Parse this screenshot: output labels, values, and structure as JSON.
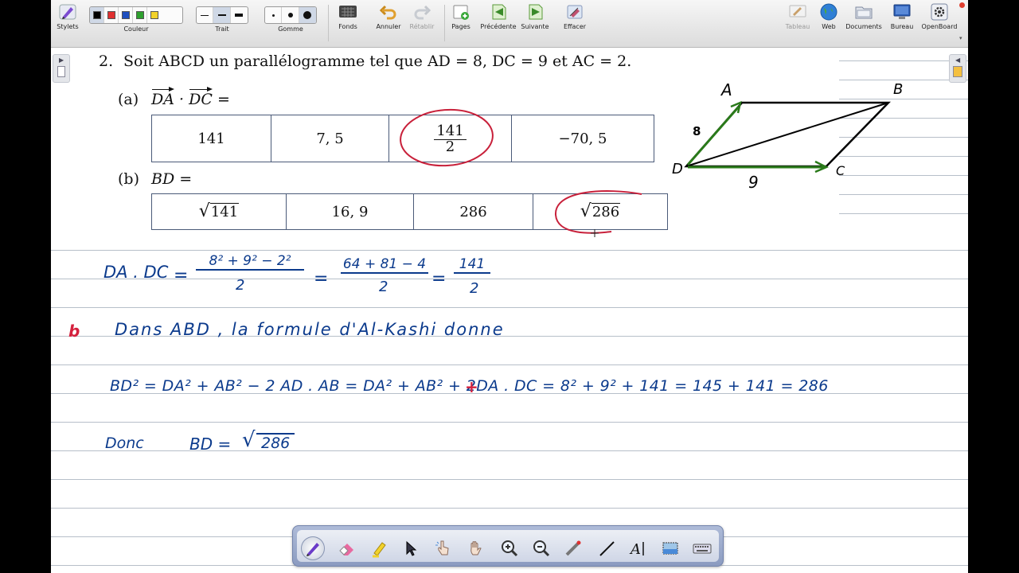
{
  "toolbar": {
    "stylets": "Stylets",
    "couleur": "Couleur",
    "trait": "Trait",
    "gomme": "Gomme",
    "fonds": "Fonds",
    "annuler": "Annuler",
    "retablir": "Rétablir",
    "pages": "Pages",
    "precedente": "Précédente",
    "suivante": "Suivante",
    "effacer": "Effacer",
    "tableau": "Tableau",
    "web": "Web",
    "documents": "Documents",
    "bureau": "Bureau",
    "openboard": "OpenBoard",
    "colors": [
      "#000000",
      "#e03030",
      "#1f4fbf",
      "#2ea02e",
      "#f2d22a"
    ]
  },
  "problem": {
    "number": "2.",
    "statement": "Soit ABCD un parallélogramme tel que AD = 8, DC = 9 et AC = 2.",
    "a_label": "(a)",
    "a_vec1": "DA",
    "a_dot": "·",
    "a_vec2": "DC",
    "a_eq": "=",
    "a_answers": [
      "141",
      "7, 5",
      "141",
      "2",
      "−70, 5"
    ],
    "b_label": "(b)",
    "b_expr": "BD =",
    "b_answers": [
      "141",
      "16, 9",
      "286",
      "286"
    ]
  },
  "figure": {
    "labels": [
      "A",
      "B",
      "D",
      "C",
      "8",
      "9"
    ]
  },
  "handwriting": {
    "line1_left": "DA . DC",
    "line1_eq": "=",
    "line1_frac1_num": "8² + 9² − 2²",
    "line1_frac1_den": "2",
    "line1_frac2_num": "64 + 81 − 4",
    "line1_frac2_den": "2",
    "line1_frac3_num": "141",
    "line1_frac3_den": "2",
    "b_marker": "b",
    "line2": "Dans ABD , la formule d'Al-Kashi donne",
    "line3": "BD² = DA² + AB² − 2 AD . AB = DA² + AB² + 2DA . DC = 8² + 9² + 141 = 145 + 141 = 286",
    "line4_left": "Donc",
    "line4_mid": "BD =",
    "line4_val": "286"
  },
  "bottom_tools": [
    "pen-tool",
    "eraser-tool",
    "marker-tool",
    "selector-tool",
    "interact-tool",
    "hand-tool",
    "zoom-in-tool",
    "zoom-out-tool",
    "laser-tool",
    "line-tool",
    "text-tool",
    "capture-tool",
    "keyboard-tool"
  ]
}
